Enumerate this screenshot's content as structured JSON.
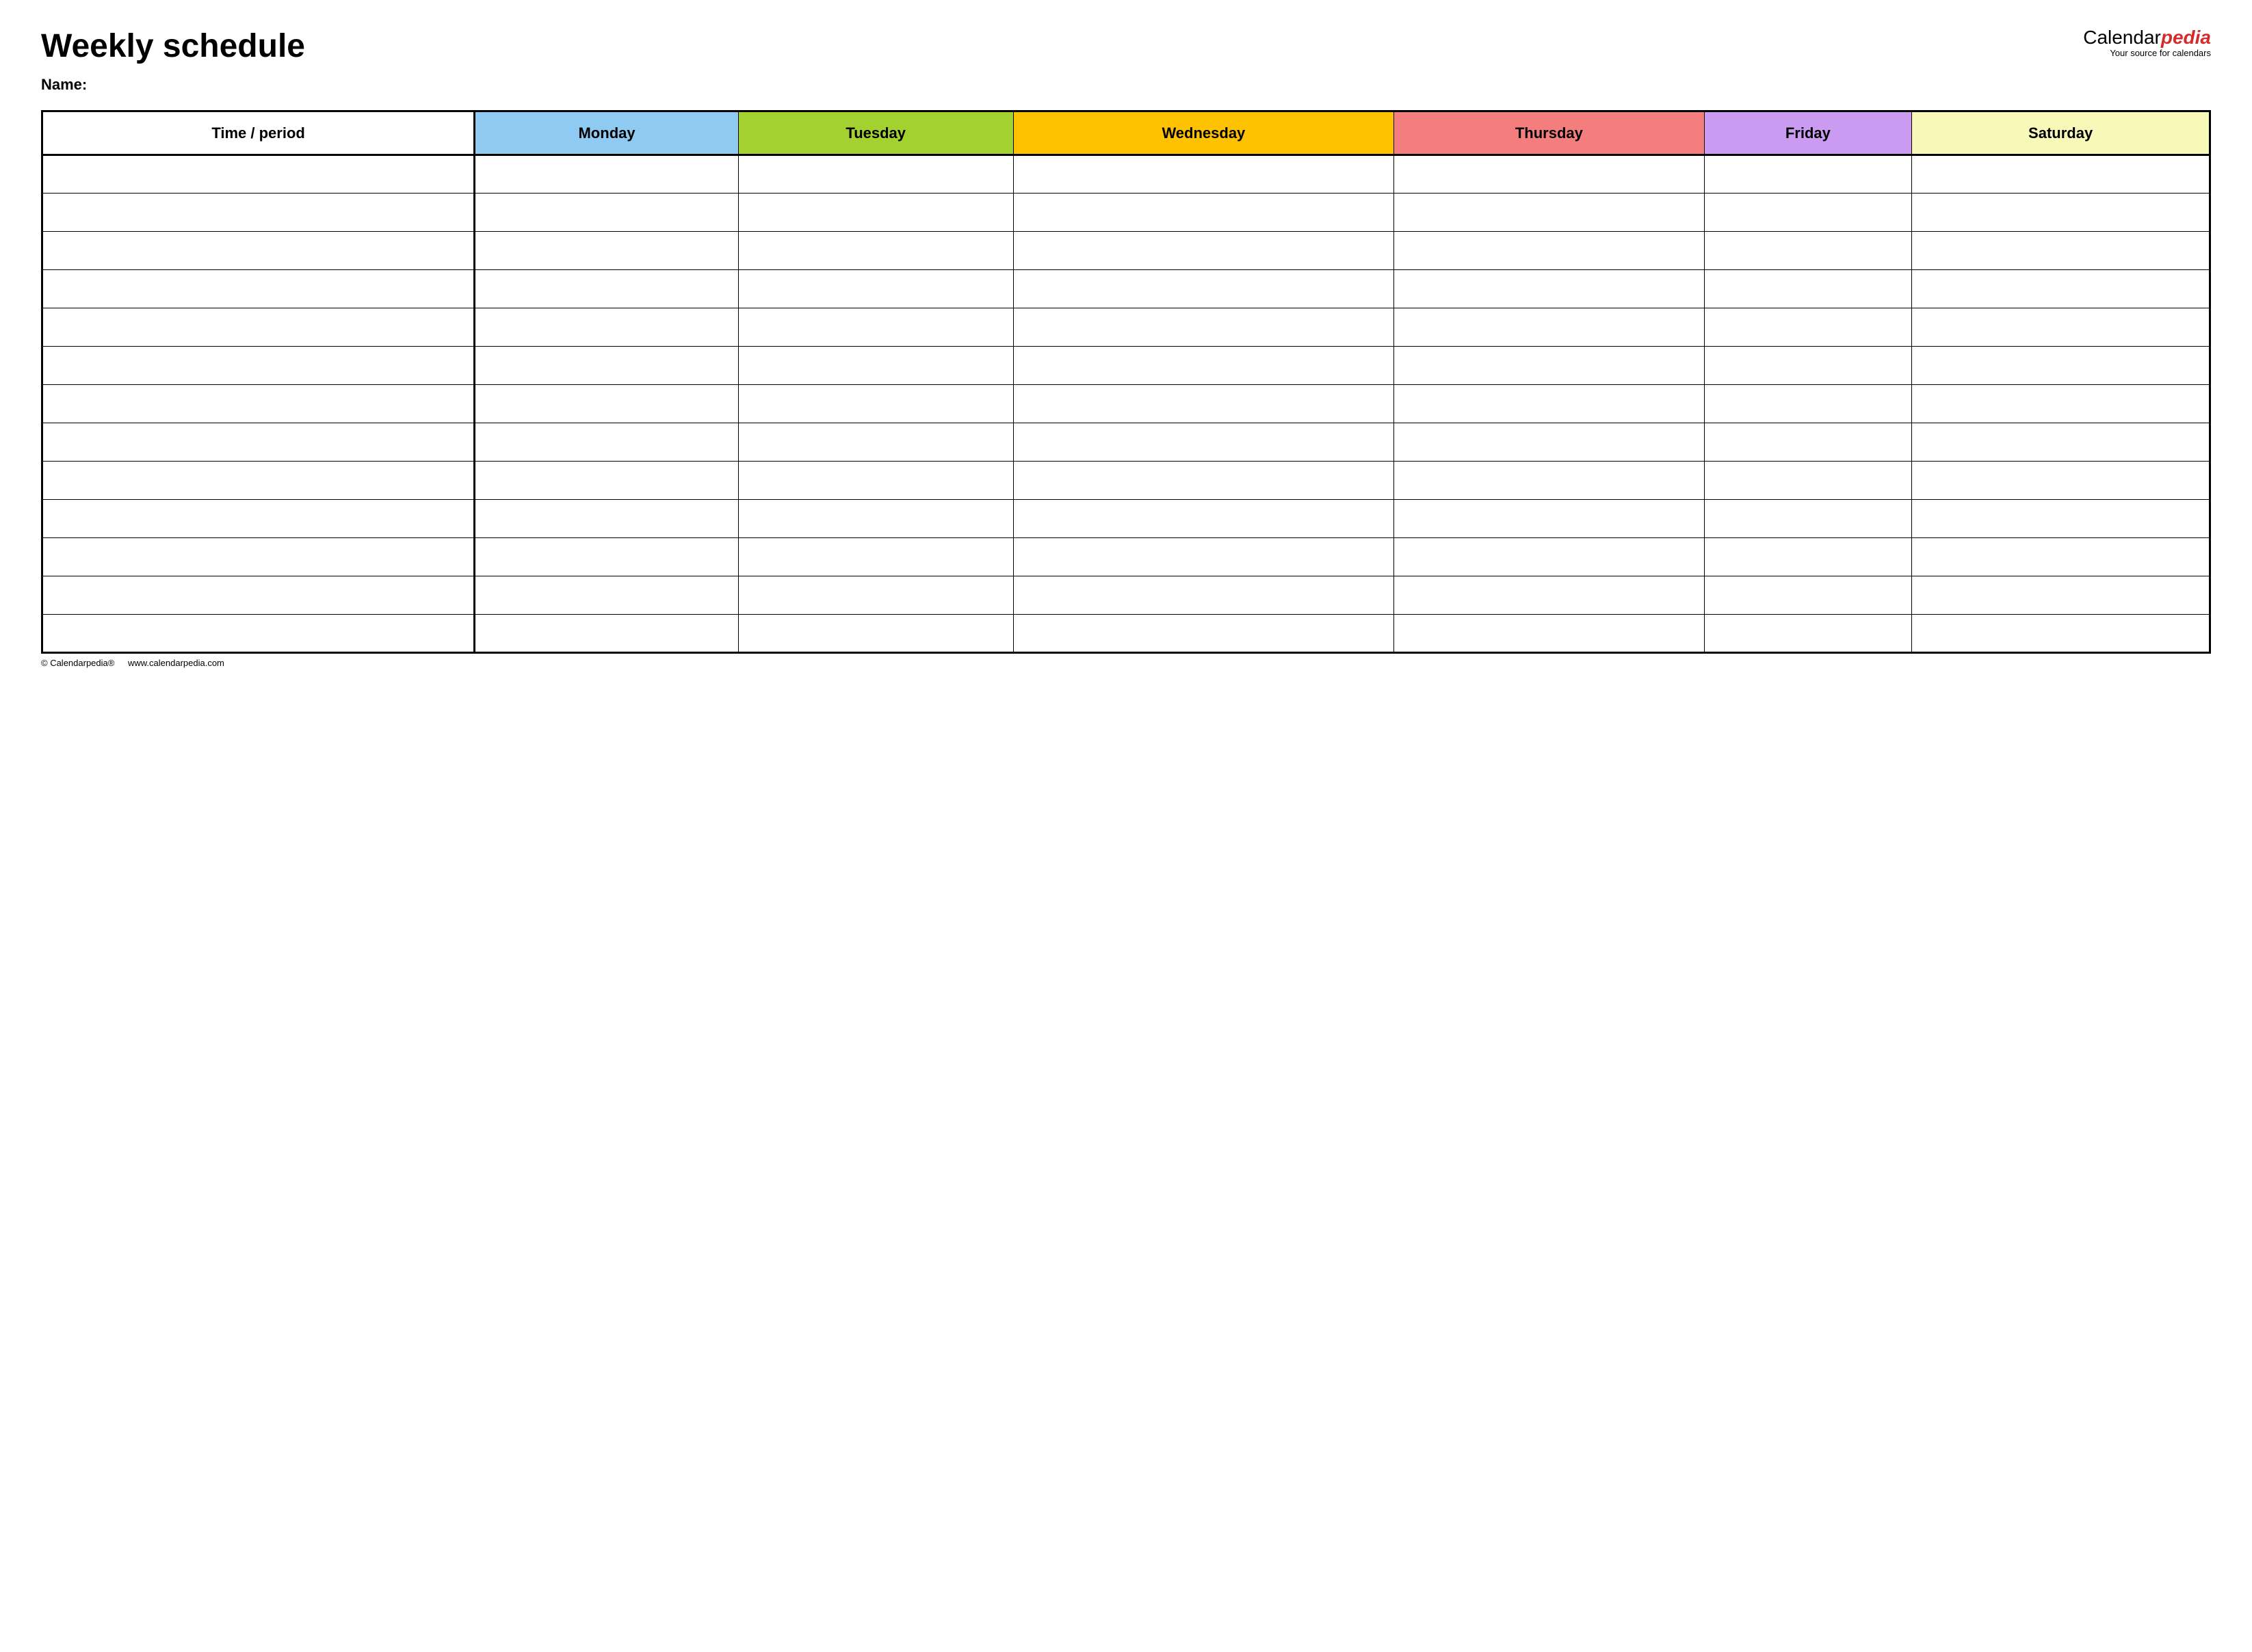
{
  "header": {
    "title": "Weekly schedule",
    "brand_prefix": "Calendar",
    "brand_suffix": "pedia",
    "brand_tagline": "Your source for calendars"
  },
  "name_label": "Name:",
  "columns": [
    {
      "label": "Time / period",
      "color": "#ffffff"
    },
    {
      "label": "Monday",
      "color": "#8ecaf2"
    },
    {
      "label": "Tuesday",
      "color": "#a3d130"
    },
    {
      "label": "Wednesday",
      "color": "#ffc200"
    },
    {
      "label": "Thursday",
      "color": "#f47d7d"
    },
    {
      "label": "Friday",
      "color": "#cb9bf2"
    },
    {
      "label": "Saturday",
      "color": "#f8f8b8"
    }
  ],
  "row_count": 13,
  "footer": {
    "copyright": "© Calendarpedia®",
    "url": "www.calendarpedia.com"
  }
}
